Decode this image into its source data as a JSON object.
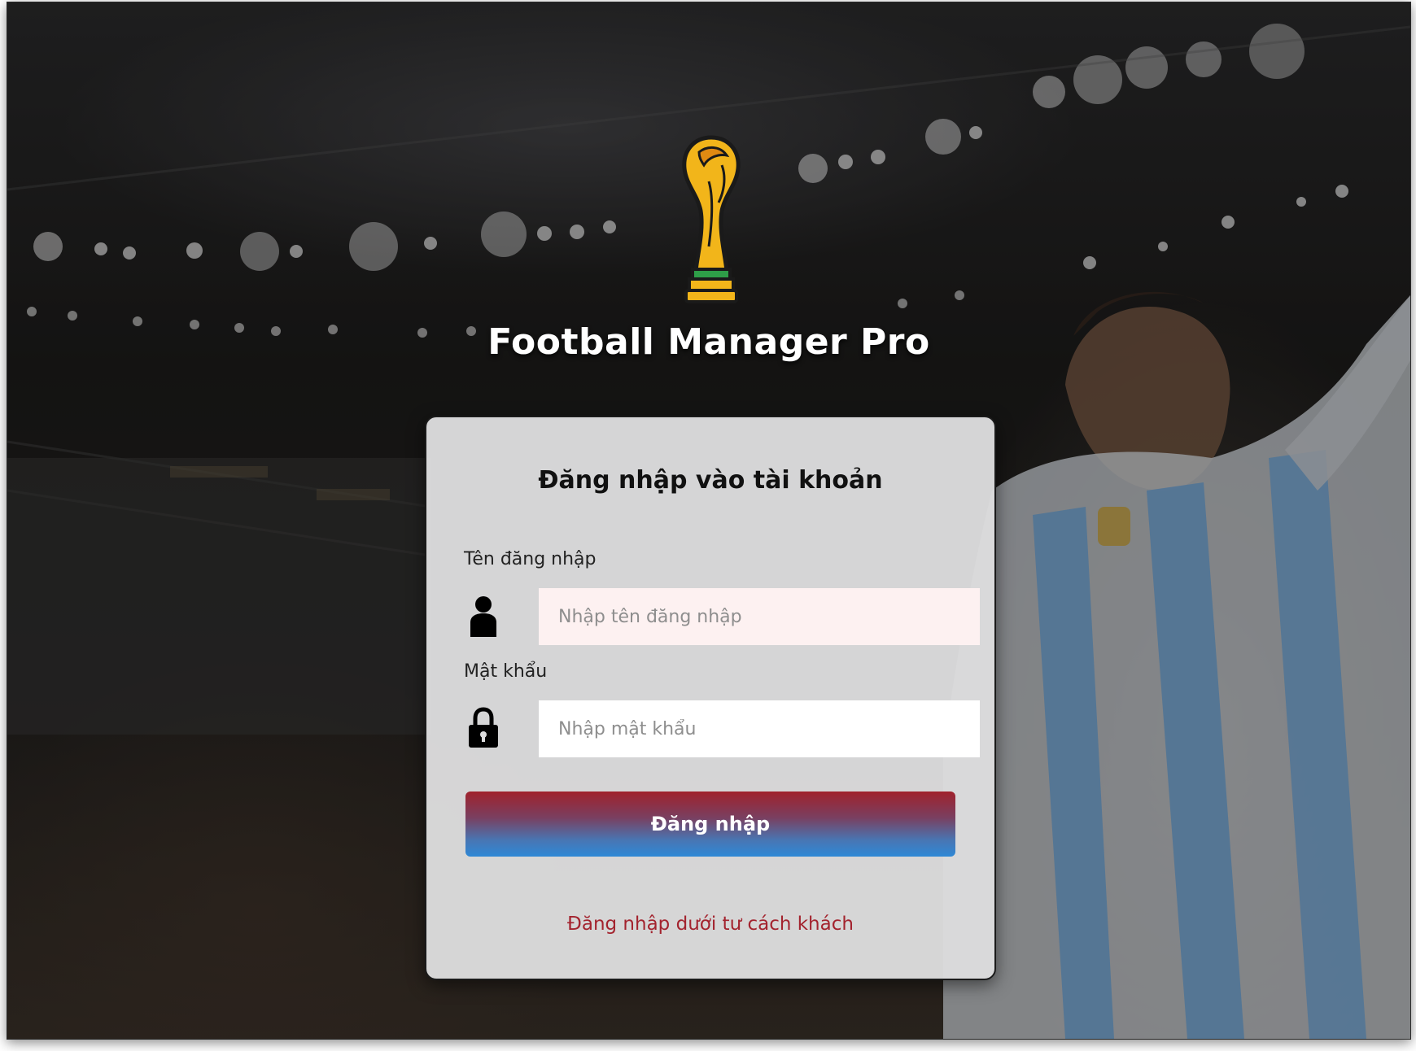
{
  "app": {
    "title": "Football Manager Pro",
    "logo_icon": "trophy-icon"
  },
  "login_card": {
    "heading": "Đăng nhập vào tài khoản",
    "username": {
      "label": "Tên đăng nhập",
      "placeholder": "Nhập tên đăng nhập",
      "value": "",
      "icon": "user-icon"
    },
    "password": {
      "label": "Mật khẩu",
      "placeholder": "Nhập mật khẩu",
      "value": "",
      "icon": "lock-icon"
    },
    "submit_label": "Đăng nhập",
    "guest_link": "Đăng nhập dưới tư cách khách"
  },
  "colors": {
    "accent_red": "#a3232e",
    "accent_blue": "#2e88d6",
    "card_bg": "#dcdcdd",
    "username_field_bg": "#fdf1f1"
  }
}
